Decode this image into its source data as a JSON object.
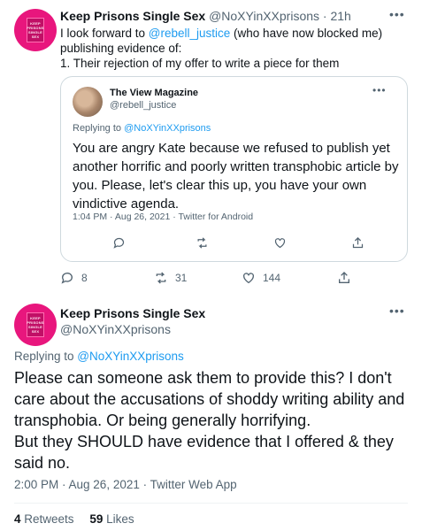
{
  "tweet1": {
    "avatar_text": [
      "KEEP",
      "PRISONS",
      "SINGLE",
      "SEX"
    ],
    "name": "Keep Prisons Single Sex",
    "handle": "@NoXYinXXprisons",
    "separator": "·",
    "time": "21h",
    "body_before": "I look forward to ",
    "mention": "@rebell_justice",
    "body_after": " (who have now blocked me) publishing evidence of:",
    "body_line2": "1. Their rejection of my offer to write a piece for them",
    "replies": "8",
    "retweets": "31",
    "likes": "144"
  },
  "quote": {
    "name": "The View Magazine",
    "handle": "@rebell_justice",
    "replying_prefix": "Replying to ",
    "replying_to": "@NoXYinXXprisons",
    "text": "You are angry Kate because we refused to publish yet another horrific and poorly written transphobic article by you. Please, let's clear this up, you have your own vindictive agenda.",
    "timestamp": "1:04 PM · Aug 26, 2021 · Twitter for Android"
  },
  "tweet2": {
    "avatar_text": [
      "KEEP",
      "PRISONS",
      "SINGLE",
      "SEX"
    ],
    "name": "Keep Prisons Single Sex",
    "handle": "@NoXYinXXprisons",
    "replying_prefix": "Replying to ",
    "replying_to": "@NoXYinXXprisons",
    "text_line1": "Please can someone ask them to provide this? I don't care about the accusations of shoddy writing ability and transphobia. Or being generally horrifying.",
    "text_line2": "But they SHOULD have evidence that I offered & they said no.",
    "timestamp": "2:00 PM · Aug 26, 2021 · Twitter Web App",
    "retweets_count": "4",
    "retweets_label": "Retweets",
    "likes_count": "59",
    "likes_label": "Likes"
  },
  "icons": {
    "more": "more-icon",
    "reply": "reply-icon",
    "retweet": "retweet-icon",
    "like": "heart-icon",
    "share": "share-icon"
  },
  "colors": {
    "link": "#1d9bf0",
    "secondary_text": "#536471",
    "avatar_bg": "#e8167d"
  }
}
